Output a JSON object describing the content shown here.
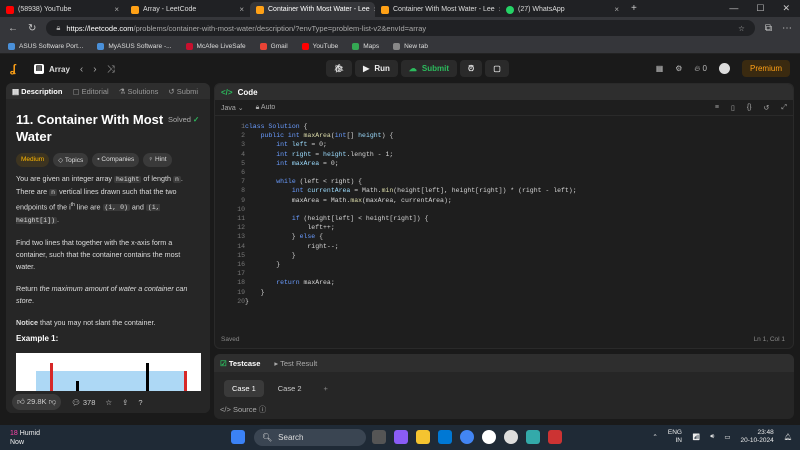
{
  "browser": {
    "tabs": [
      {
        "label": "(58938) YouTube",
        "color": "#ff0000",
        "active": false
      },
      {
        "label": "Array - LeetCode",
        "color": "#ffa116",
        "active": false
      },
      {
        "label": "Container With Most Water - Lee",
        "color": "#ffa116",
        "active": true
      },
      {
        "label": "Container With Most Water - Lee",
        "color": "#ffa116",
        "active": false
      },
      {
        "label": "(27) WhatsApp",
        "color": "#25d366",
        "active": false
      }
    ],
    "url_domain": "https://leetcode.com",
    "url_path": "/problems/container-with-most-water/description/?envType=problem-list-v2&envId=array",
    "bookmarks": [
      {
        "label": "ASUS Software Port...",
        "color": "#4a90d9"
      },
      {
        "label": "MyASUS Software -...",
        "color": "#4a90d9"
      },
      {
        "label": "McAfee LiveSafe",
        "color": "#c8102e"
      },
      {
        "label": "Gmail",
        "color": "#ea4335"
      },
      {
        "label": "YouTube",
        "color": "#ff0000"
      },
      {
        "label": "Maps",
        "color": "#34a853"
      },
      {
        "label": "New tab",
        "color": "#888888"
      }
    ]
  },
  "nav": {
    "list_label": "Array",
    "run_label": "Run",
    "submit_label": "Submit",
    "coins": "0",
    "premium_label": "Premium"
  },
  "left": {
    "tabs": [
      "Description",
      "Editorial",
      "Solutions",
      "Submi"
    ],
    "title": "11. Container With Most Water",
    "solved_label": "Solved",
    "tags": [
      "Medium",
      "Topics",
      "Companies",
      "Hint"
    ],
    "desc": {
      "p1_a": "You are given an integer array ",
      "p1_code1": "height",
      "p1_b": " of length ",
      "p1_code2": "n",
      "p1_c": ". There are ",
      "p1_code3": "n",
      "p1_d": " vertical lines drawn such that the two endpoints of the ",
      "p1_sup": "th",
      "p1_e": " line are ",
      "p1_code4": "(i, 0)",
      "p1_f": " and ",
      "p1_code5": "(i, height[i])",
      "p1_g": ".",
      "p2": "Find two lines that together with the x-axis form a container, such that the container contains the most water.",
      "p3_a": "Return ",
      "p3_em": "the maximum amount of water a container can store",
      "p3_b": ".",
      "p4_b": "Notice",
      "p4_rest": " that you may not slant the container."
    },
    "example_label": "Example 1:",
    "likes": "29.8K",
    "comments": "378"
  },
  "code": {
    "header": "Code",
    "language": "Java",
    "autosave": "Auto",
    "saved": "Saved",
    "position": "Ln 1, Col 1"
  },
  "test": {
    "tabs": [
      "Testcase",
      "Test Result"
    ],
    "cases": [
      "Case 1",
      "Case 2"
    ],
    "source": "Source"
  },
  "taskbar": {
    "weather_temp": "18",
    "weather_label": "Humid",
    "weather_sub": "Now",
    "search_label": "Search",
    "lang": "ENG",
    "lang_sub": "IN",
    "time": "23:48",
    "date": "20-10-2024"
  }
}
